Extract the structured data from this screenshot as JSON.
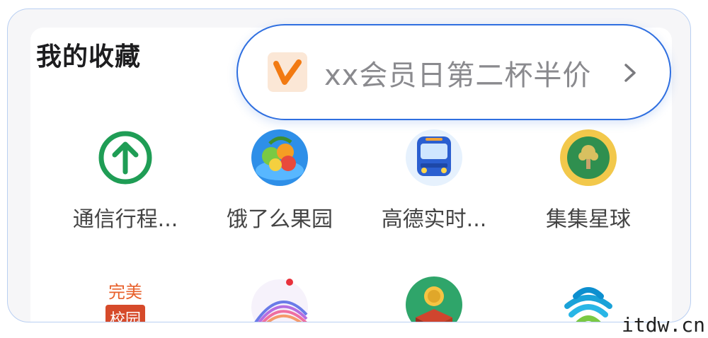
{
  "section": {
    "title": "我的收藏"
  },
  "favorites": [
    {
      "label": "通信行程...",
      "icon": "arrow-up-circle-icon"
    },
    {
      "label": "饿了么果园",
      "icon": "orchard-icon"
    },
    {
      "label": "高德实时...",
      "icon": "bus-icon"
    },
    {
      "label": "集集星球",
      "icon": "planet-icon"
    }
  ],
  "second_row": [
    {
      "icon": "campus-icon",
      "icon_text": [
        "完美",
        "校园"
      ]
    },
    {
      "icon": "rainbow-icon"
    },
    {
      "icon": "coin-treasure-icon"
    },
    {
      "icon": "china-mobile-icon"
    }
  ],
  "toast": {
    "text": "xx会员日第二杯半价",
    "icon": "v-logo-icon"
  },
  "colors": {
    "accent": "#2f6fe0",
    "green": "#1f9d55",
    "text": "#444444"
  },
  "watermark": "itdw.cn"
}
